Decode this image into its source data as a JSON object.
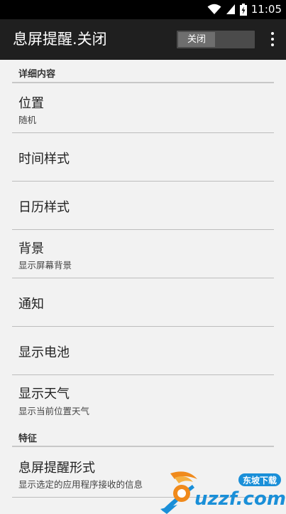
{
  "status_bar": {
    "time": "11:05"
  },
  "app_bar": {
    "title": "息屏提醒.关闭",
    "toggle_label": "关闭"
  },
  "sections": [
    {
      "header": "详细内容"
    },
    {
      "header": "特征"
    }
  ],
  "prefs": {
    "position": {
      "title": "位置",
      "summary": "随机"
    },
    "time_style": {
      "title": "时间样式"
    },
    "calendar_style": {
      "title": "日历样式"
    },
    "background": {
      "title": "背景",
      "summary": "显示屏幕背景"
    },
    "notification": {
      "title": "通知"
    },
    "battery": {
      "title": "显示电池"
    },
    "weather": {
      "title": "显示天气",
      "summary": "显示当前位置天气"
    },
    "reminder_form": {
      "title": "息屏提醒形式",
      "summary": "显示选定的应用程序接收的信息"
    }
  },
  "watermark": {
    "text_cn": "东坡下载",
    "text_en": "uzzf.com"
  },
  "colors": {
    "app_bar": "#1f1f1f",
    "background": "#f2f2f2",
    "watermark_orange": "#f08a1c",
    "watermark_blue": "#1a8fd8"
  }
}
